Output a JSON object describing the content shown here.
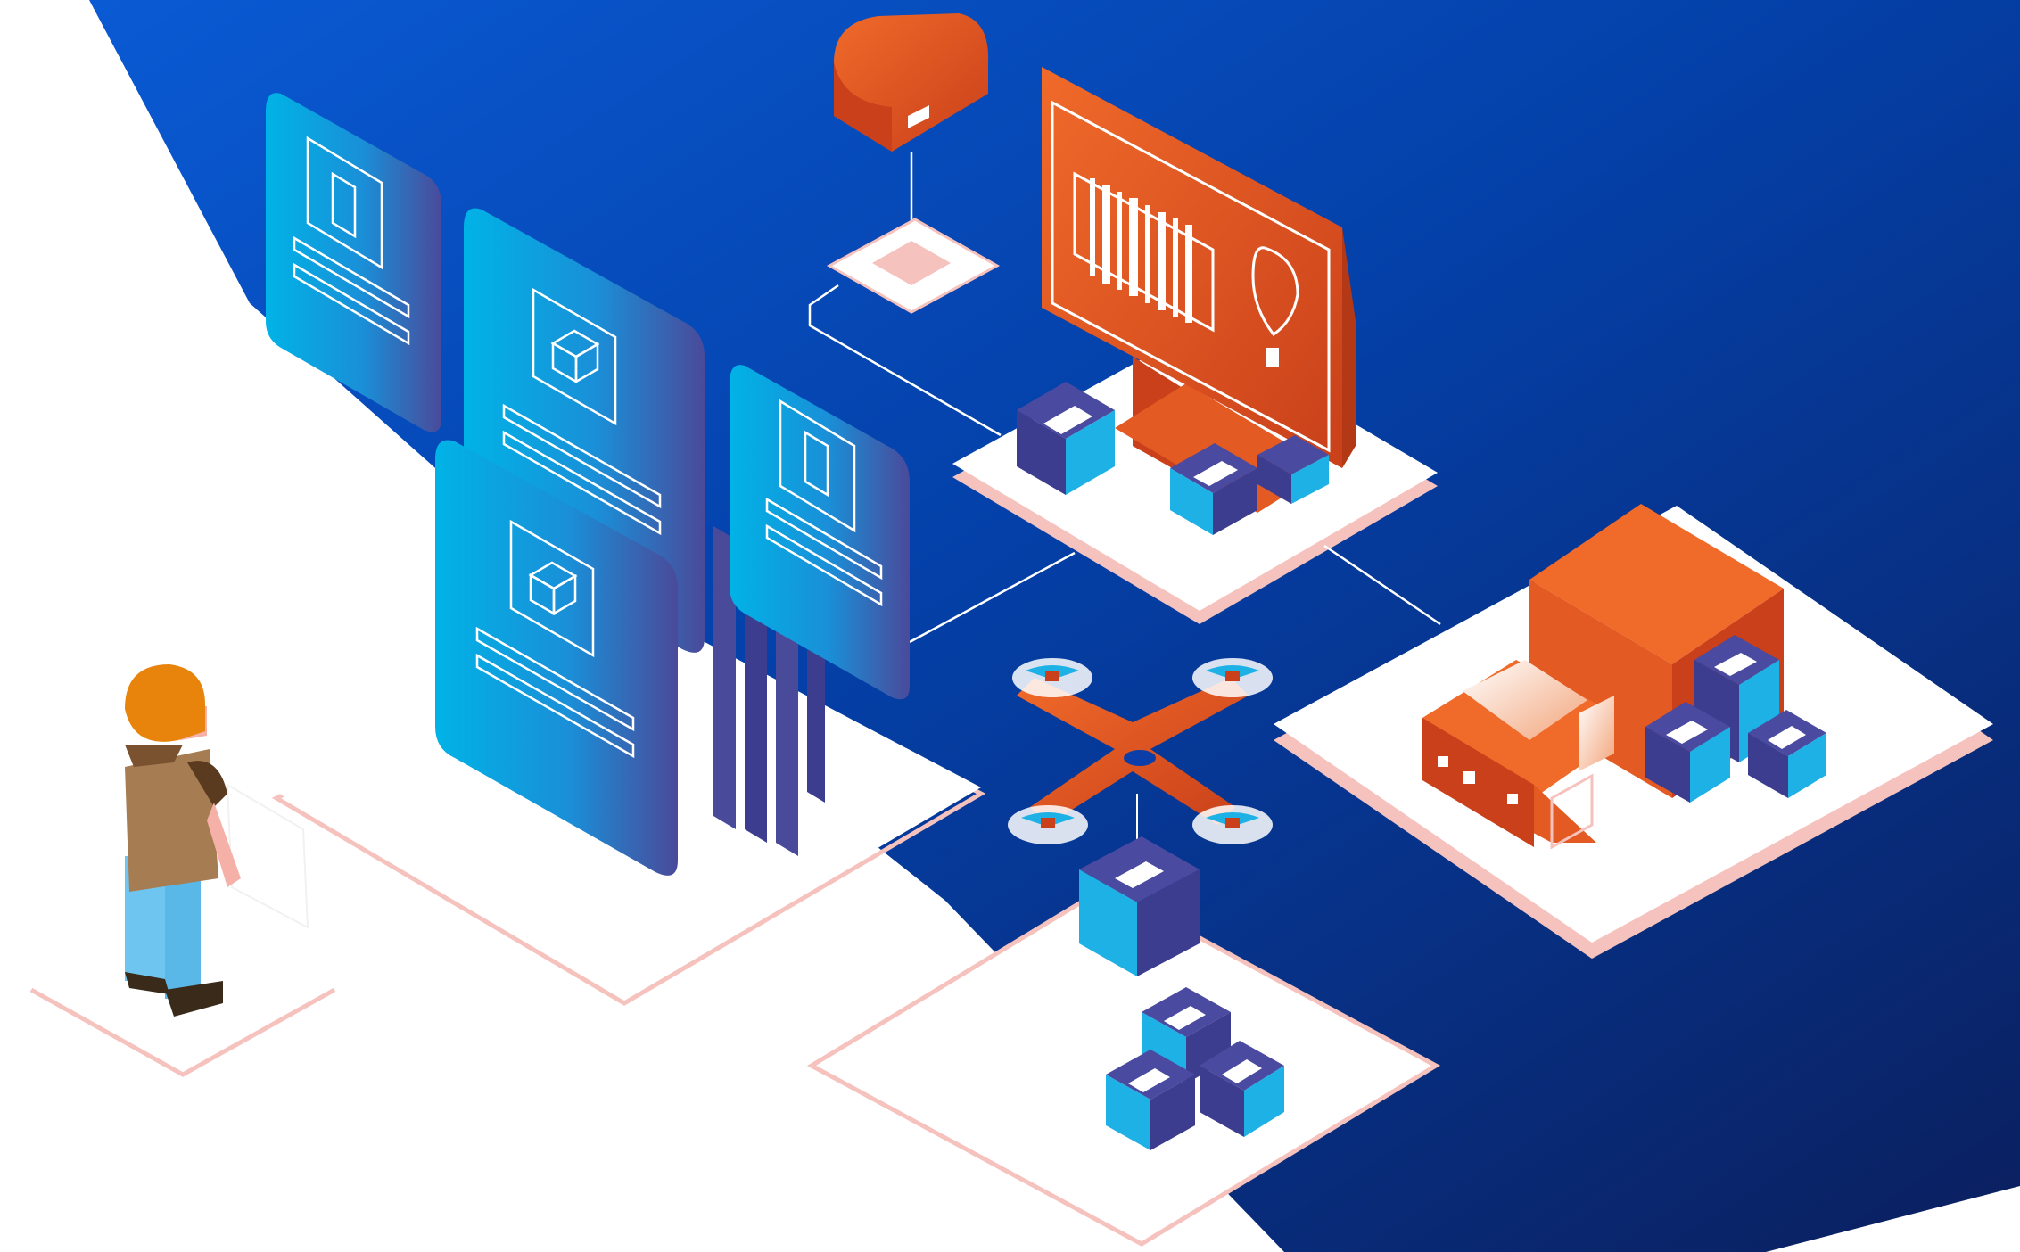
{
  "illustration": {
    "subject": "isometric-logistics-scene",
    "colors": {
      "bg_blue_start": "#0a5ad4",
      "bg_blue_end": "#0b1f5e",
      "orange_light": "#f06a2a",
      "orange_dark": "#c9401a",
      "card_cyan": "#00b3e6",
      "card_purple": "#4a4a9a",
      "box_cyan": "#1db1e6",
      "box_purple": "#3d3d8f",
      "platform": "#ffffff",
      "platform_edge": "#f6c2bd",
      "person_hair": "#e8830c",
      "person_shirt": "#a67c52",
      "person_pants": "#6ec6f0"
    },
    "icons": [
      "mobile-phone-icon",
      "package-box-icon",
      "barcode-icon",
      "map-pin-icon",
      "mailbox-icon",
      "drone-icon",
      "delivery-truck-icon",
      "person-icon"
    ]
  }
}
